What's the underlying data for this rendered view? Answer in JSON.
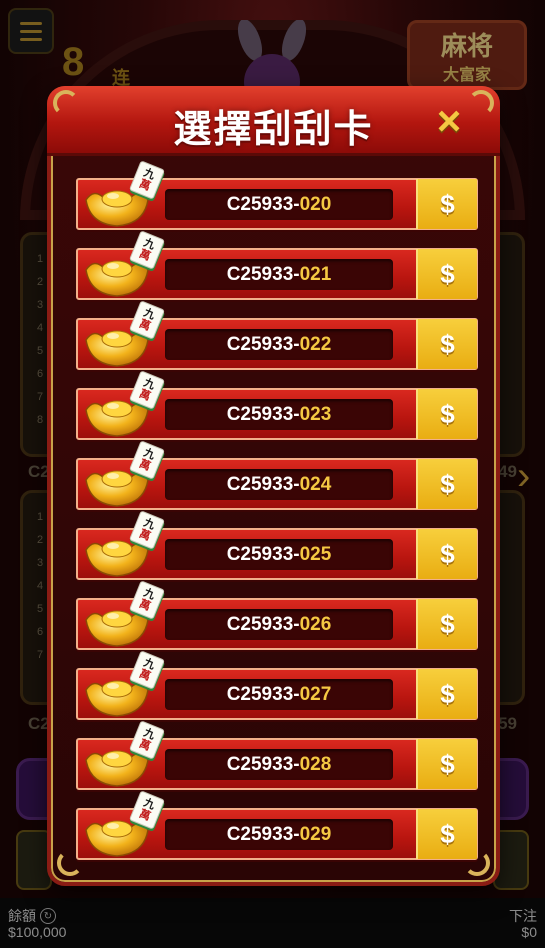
{
  "dialog": {
    "title": "選擇刮刮卡",
    "close_icon": "×",
    "cards": [
      {
        "prefix": "C25933-",
        "suffix": "020",
        "price_icon": "$",
        "tile_top": "九",
        "tile_bottom": "萬"
      },
      {
        "prefix": "C25933-",
        "suffix": "021",
        "price_icon": "$",
        "tile_top": "九",
        "tile_bottom": "萬"
      },
      {
        "prefix": "C25933-",
        "suffix": "022",
        "price_icon": "$",
        "tile_top": "九",
        "tile_bottom": "萬"
      },
      {
        "prefix": "C25933-",
        "suffix": "023",
        "price_icon": "$",
        "tile_top": "九",
        "tile_bottom": "萬"
      },
      {
        "prefix": "C25933-",
        "suffix": "024",
        "price_icon": "$",
        "tile_top": "九",
        "tile_bottom": "萬"
      },
      {
        "prefix": "C25933-",
        "suffix": "025",
        "price_icon": "$",
        "tile_top": "九",
        "tile_bottom": "萬"
      },
      {
        "prefix": "C25933-",
        "suffix": "026",
        "price_icon": "$",
        "tile_top": "九",
        "tile_bottom": "萬"
      },
      {
        "prefix": "C25933-",
        "suffix": "027",
        "price_icon": "$",
        "tile_top": "九",
        "tile_bottom": "萬"
      },
      {
        "prefix": "C25933-",
        "suffix": "028",
        "price_icon": "$",
        "tile_top": "九",
        "tile_bottom": "萬"
      },
      {
        "prefix": "C25933-",
        "suffix": "029",
        "price_icon": "$",
        "tile_top": "九",
        "tile_bottom": "萬"
      }
    ]
  },
  "background": {
    "logo_line1": "麻将",
    "logo_line2": "大富家",
    "badge_digit": "8",
    "badge_text": "连",
    "left_tag_1": "C2",
    "left_tag_2": "C2",
    "right_tag_1": "49",
    "right_tag_2": "59",
    "row_numbers": [
      "1",
      "2",
      "3",
      "4",
      "5",
      "6",
      "7",
      "8"
    ]
  },
  "footer": {
    "balance_label": "餘額",
    "balance_value": "$100,000",
    "bet_label": "下注",
    "bet_value": "$0"
  },
  "colors": {
    "accent_gold": "#f5c843",
    "card_red": "#c21a12",
    "modal_dark": "#2a0505"
  },
  "icons": {
    "menu": "hamburger-menu-icon",
    "close": "close-icon",
    "buy": "dollar-icon",
    "refresh": "refresh-icon",
    "ingot": "gold-ingot-icon",
    "tile": "mahjong-tile-icon"
  }
}
